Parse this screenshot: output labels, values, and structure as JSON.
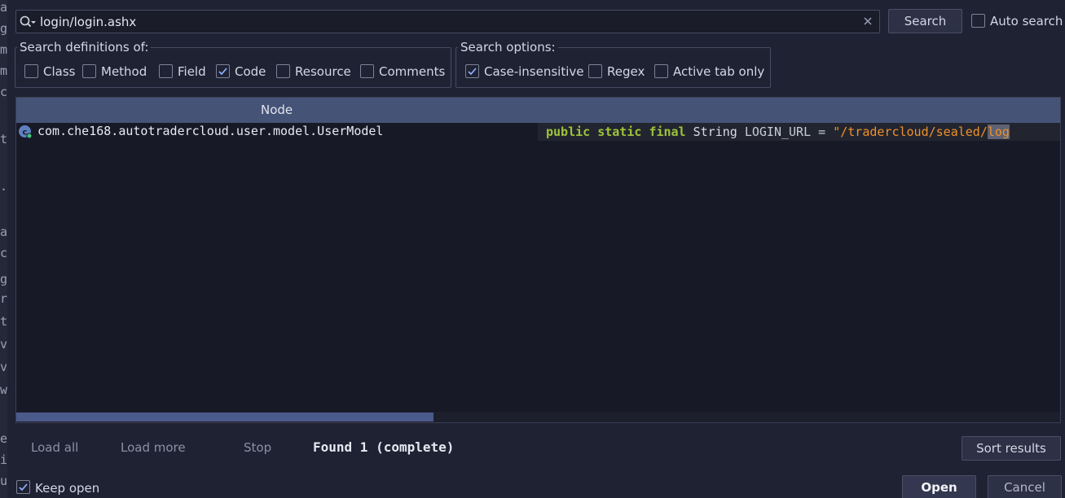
{
  "search": {
    "query": "login/login.ashx",
    "button_label": "Search",
    "auto_search": {
      "label": "Auto search",
      "checked": false
    }
  },
  "definitions": {
    "title": "Search definitions of:",
    "options": [
      {
        "label": "Class",
        "checked": false
      },
      {
        "label": "Method",
        "checked": false
      },
      {
        "label": "Field",
        "checked": false
      },
      {
        "label": "Code",
        "checked": true
      },
      {
        "label": "Resource",
        "checked": false
      },
      {
        "label": "Comments",
        "checked": false
      }
    ]
  },
  "search_options": {
    "title": "Search options:",
    "options": [
      {
        "label": "Case-insensitive",
        "checked": true
      },
      {
        "label": "Regex",
        "checked": false
      },
      {
        "label": "Active tab only",
        "checked": false
      }
    ]
  },
  "results": {
    "columns": [
      "Node"
    ],
    "rows": [
      {
        "node": "com.che168.autotradercloud.user.model.UserModel",
        "icon": "class-icon",
        "code": {
          "kw1": "public",
          "kw2": "static",
          "kw3": "final",
          "type": "String",
          "ident": "LOGIN_URL",
          "eq": "=",
          "str_pre": "\"/tradercloud/sealed/",
          "str_match": "log"
        }
      }
    ]
  },
  "footer": {
    "load_all": "Load all",
    "load_more": "Load more",
    "stop": "Stop",
    "found": "Found 1 (complete)",
    "sort_results": "Sort results",
    "keep_open": {
      "label": "Keep open",
      "checked": true
    },
    "open": "Open",
    "cancel": "Cancel"
  },
  "editor_strip": [
    "a",
    "g",
    "m",
    "m",
    "c",
    "t",
    ".",
    "a",
    "c",
    "g",
    "r",
    "t",
    "v",
    "v",
    "w",
    "e",
    "i",
    "u"
  ],
  "colors": {
    "accent": "#455377",
    "string": "#f0902a",
    "keyword": "#9ec33a",
    "check": "#8fb0ff"
  }
}
